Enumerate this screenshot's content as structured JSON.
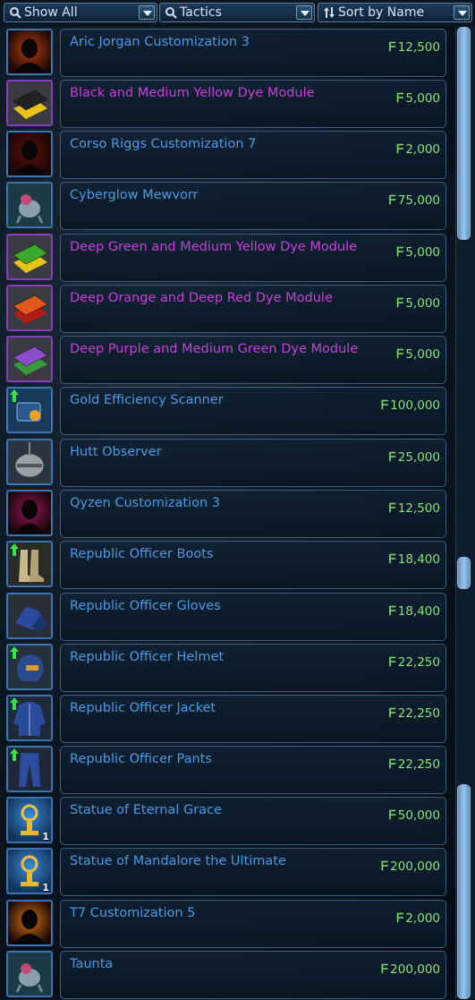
{
  "filters": {
    "category": {
      "label": "Show All",
      "icon": "search-icon"
    },
    "type": {
      "label": "Tactics",
      "icon": "search-icon"
    },
    "sort": {
      "label": "Sort by Name",
      "icon": "sort-arrows-icon"
    }
  },
  "colors": {
    "blue_item": "#4c9ae4",
    "purple_item": "#c840d8",
    "price": "#8ae47a"
  },
  "items": [
    {
      "name": "Aric Jorgan Customization 3",
      "price": "12,500",
      "rarity": "blue",
      "icon": "customization-portrait-icon"
    },
    {
      "name": "Black and Medium Yellow Dye Module",
      "price": "5,000",
      "rarity": "purple",
      "icon": "dye-module-icon"
    },
    {
      "name": "Corso Riggs Customization 7",
      "price": "2,000",
      "rarity": "blue",
      "icon": "customization-portrait-icon"
    },
    {
      "name": "Cyberglow Mewvorr",
      "price": "75,000",
      "rarity": "blue",
      "icon": "pet-icon"
    },
    {
      "name": "Deep Green and Medium Yellow Dye Module",
      "price": "5,000",
      "rarity": "purple",
      "icon": "dye-module-icon"
    },
    {
      "name": "Deep Orange and Deep Red Dye Module",
      "price": "5,000",
      "rarity": "purple",
      "icon": "dye-module-icon"
    },
    {
      "name": "Deep Purple and Medium Green Dye Module",
      "price": "5,000",
      "rarity": "purple",
      "icon": "dye-module-icon"
    },
    {
      "name": "Gold Efficiency Scanner",
      "price": "100,000",
      "rarity": "blue",
      "icon": "scanner-icon"
    },
    {
      "name": "Hutt Observer",
      "price": "25,000",
      "rarity": "blue",
      "icon": "droid-icon"
    },
    {
      "name": "Qyzen Customization 3",
      "price": "12,500",
      "rarity": "blue",
      "icon": "customization-portrait-icon"
    },
    {
      "name": "Republic Officer Boots",
      "price": "18,400",
      "rarity": "blue",
      "icon": "boots-icon"
    },
    {
      "name": "Republic Officer Gloves",
      "price": "18,400",
      "rarity": "blue",
      "icon": "gloves-icon"
    },
    {
      "name": "Republic Officer Helmet",
      "price": "22,250",
      "rarity": "blue",
      "icon": "helmet-icon"
    },
    {
      "name": "Republic Officer Jacket",
      "price": "22,250",
      "rarity": "blue",
      "icon": "jacket-icon"
    },
    {
      "name": "Republic Officer Pants",
      "price": "22,250",
      "rarity": "blue",
      "icon": "pants-icon"
    },
    {
      "name": "Statue of Eternal Grace",
      "price": "50,000",
      "rarity": "blue",
      "icon": "statue-icon",
      "qty": "1"
    },
    {
      "name": "Statue of Mandalore the Ultimate",
      "price": "200,000",
      "rarity": "blue",
      "icon": "statue-icon",
      "qty": "1"
    },
    {
      "name": "T7 Customization 5",
      "price": "2,000",
      "rarity": "blue",
      "icon": "customization-portrait-icon"
    },
    {
      "name": "Taunta",
      "price": "200,000",
      "rarity": "blue",
      "icon": "pet-icon"
    }
  ],
  "currency_symbol": "ᖴ"
}
